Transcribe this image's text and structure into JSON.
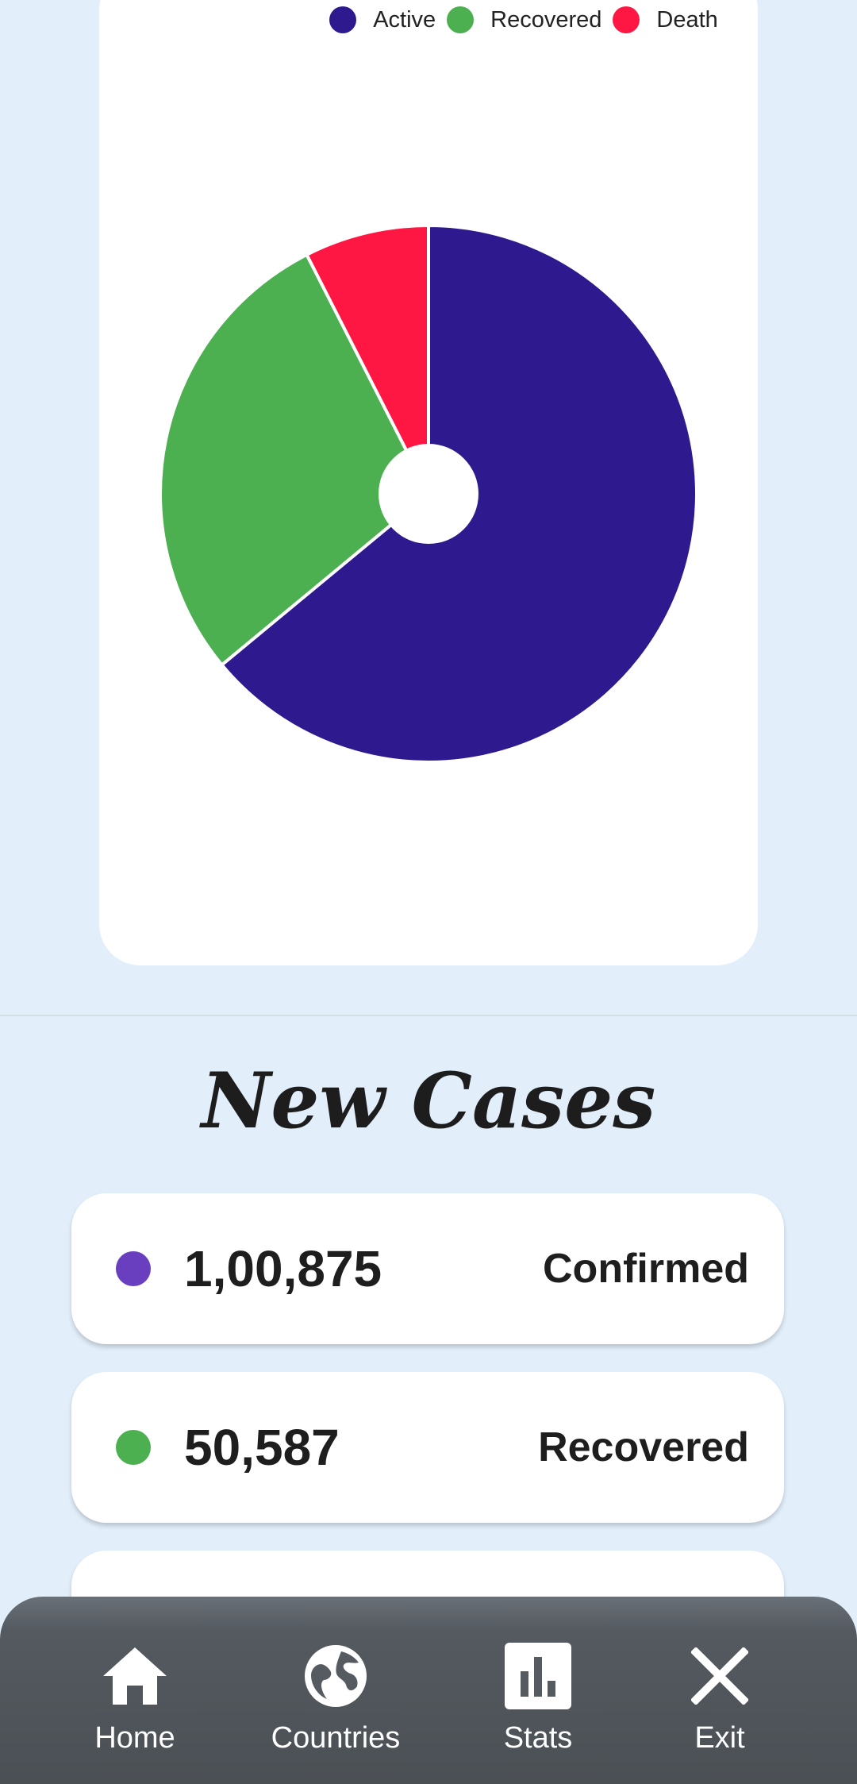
{
  "chart_data": {
    "type": "pie",
    "legend_position": "top",
    "legend": [
      "Active",
      "Recovered",
      "Death"
    ],
    "values": [
      64,
      28.5,
      7.5
    ],
    "colors": [
      "#2e1a8e",
      "#4caf50",
      "#ff1744"
    ]
  },
  "new_cases": {
    "title": "New Cases",
    "items": [
      {
        "value": "1,00,875",
        "label": "Confirmed",
        "color": "#6a3fbf"
      },
      {
        "value": "50,587",
        "label": "Recovered",
        "color": "#4caf50"
      }
    ]
  },
  "nav": {
    "items": [
      {
        "label": "Home",
        "icon": "home-icon"
      },
      {
        "label": "Countries",
        "icon": "globe-icon"
      },
      {
        "label": "Stats",
        "icon": "bar-chart-icon"
      },
      {
        "label": "Exit",
        "icon": "close-icon"
      }
    ]
  }
}
